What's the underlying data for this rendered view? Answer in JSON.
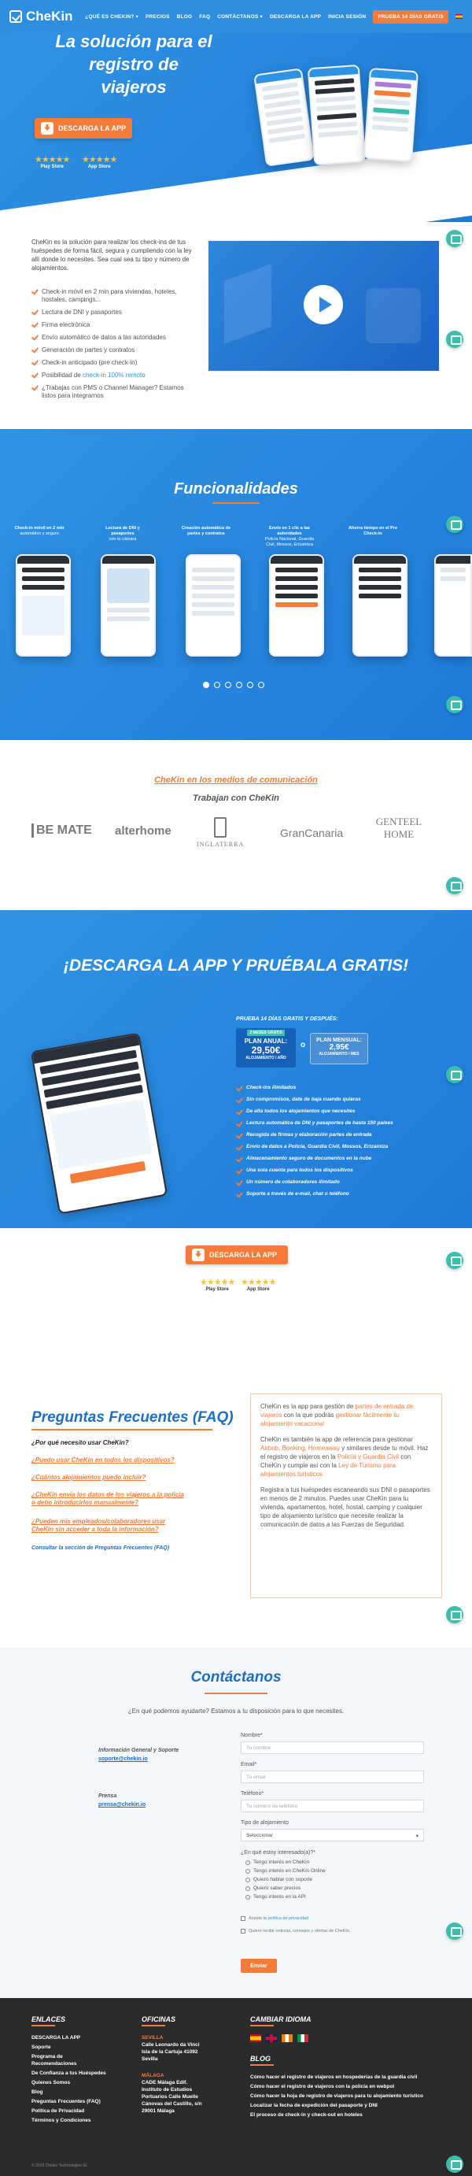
{
  "header": {
    "logo": "CheKin",
    "nav": [
      "¿QUÉ ES CHEKIN? ▾",
      "PRECIOS",
      "BLOG",
      "FAQ",
      "CONTÁCTANOS ▾",
      "DESCARGA LA APP",
      "INICIA SESIÓN"
    ],
    "trial": "PRUEBA 14 DÍAS GRATIS"
  },
  "hero": {
    "title": "La solución para el registro de viajeros",
    "download_btn": "DESCARGA LA APP",
    "stars": "★★★★★",
    "play_store": "Play Store",
    "app_store": "App Store"
  },
  "intro": {
    "text": "CheKin es la solución para realizar los check-ins de tus huéspedes de forma fácil, segura y cumpliendo con la ley allí donde lo necesites. Sea cual sea tu tipo y número de alojamientos.",
    "items": [
      "Check-in móvil en 2 min para viviendas, hoteles, hostales, campings...",
      "Lectura de DNI y pasaportes",
      "Firma electrónica",
      "Envío automático de datos a las autoridades",
      "Generación de partes y contratos",
      "Check-in anticipado (pre check-in)"
    ],
    "item_remote_pre": "Posibilidad de ",
    "item_remote_link": "check-in 100% remoto",
    "item_pms": "¿Trabajas con PMS o Channel Manager? Estamos listos para integrarnos"
  },
  "functions": {
    "title": "Funcionalidades",
    "labels": [
      "Check-in móvil en 2 min",
      "Lectura de DNI y pasaportes",
      "Creación automática de partes y contratos",
      "Envío en 1 clic a las autoridades",
      "Ahorra tiempo en el Pre Check-in",
      ""
    ],
    "sublabels": [
      "automático y seguro",
      "con tu cámara",
      "",
      "Policía Nacional, Guardia Civil, Mossos, Ertzaintza",
      "",
      ""
    ]
  },
  "media": {
    "title": "CheKin en los medios de comunicación",
    "subtitle": "Trabajan con CheKin",
    "brands": [
      "BE MATE",
      "alterhome",
      "INGLATERRA",
      "GranCanaria",
      "GENTEEL HOME"
    ]
  },
  "download": {
    "title": "¡DESCARGA LA APP Y PRUÉBALA GRATIS!",
    "trial_head": "PRUEBA 14 DÍAS GRATIS Y DESPUÉS:",
    "annual_badge": "2 MESES GRATIS",
    "annual_label": "PLAN ANUAL:",
    "annual_price": "29,50€",
    "annual_sub": "ALOJAMIENTO / AÑO",
    "or": "o",
    "monthly_label": "PLAN MENSUAL:",
    "monthly_price": "2,95€",
    "monthly_sub": "ALOJAMIENTO / MES",
    "features": [
      "Check-ins ilimitados",
      "Sin compromisos, date de baja cuando quieras",
      "De alta todos los alojamientos que necesites",
      "Lectura automática de DNI y pasaportes de hasta 150 países",
      "Recogida de firmas y elaboración partes de entrada",
      "Envío de datos a Policía, Guardia Civil, Mossos, Ertzaintza",
      "Almacenamiento seguro de documentos en la nube",
      "Una sola cuenta para todos los dispositivos",
      "Un número de colaboradores ilimitado",
      "Soporte a través de e-mail, chat o teléfono"
    ],
    "download_btn": "DESCARGA LA APP",
    "stars": "★★★★★",
    "play_store": "Play Store",
    "app_store": "App Store"
  },
  "faq": {
    "title": "Preguntas Frecuentes (FAQ)",
    "questions": [
      "¿Por qué necesito usar CheKin?",
      "¿Puedo usar CheKin en todos los dispositivos?",
      "¿Cuántos alojamientos puedo incluir?",
      "¿CheKin envía los datos de los viajeros a la policía o debo introducirlos manualmente?",
      "¿Pueden mis empleados/colaboradores usar CheKin sin acceder a toda la información?"
    ],
    "link": "Consultar la sección de Preguntas Frecuentes (FAQ)",
    "answer_p1_a": "CheKin es la app para gestión de ",
    "answer_p1_hl1": "partes de entrada de viajeros",
    "answer_p1_b": " con la que podrás ",
    "answer_p1_hl2": "gestionar fácilmente tu alojamiento vacacional",
    "answer_p2_a": "CheKin es también la app de referencia para gestionar ",
    "answer_p2_hl1": "Airbnb, Booking, Homeaway",
    "answer_p2_b": " y similares desde tu móvil. Haz el registro de viajeros en la ",
    "answer_p2_hl2": "Policía y Guardia Civil",
    "answer_p2_c": " con CheKin y cumple así con la ",
    "answer_p2_hl3": "Ley de Turismo para alojamientos turísticos",
    "answer_p3": "Registra a tus huéspedes escaneando sus DNI o pasaportes en menos de 2 minutos. Puedes usar CheKin para tu vivienda, apartamentos, hotel, hostal, camping y cualquier tipo de alojamiento turístico que necesite realizar la comunicación de datos a las Fuerzas de Seguridad."
  },
  "contact": {
    "title": "Contáctanos",
    "subtitle": "¿En qué podemos ayudarte? Estamos a tu disposición para lo que necesites.",
    "info_label": "Información General y Soporte",
    "info_email": "soporte@chekin.io",
    "press_label": "Prensa",
    "press_email": "prensa@chekin.io",
    "name_label": "Nombre*",
    "name_placeholder": "Tu nombre",
    "email_label": "Email*",
    "email_placeholder": "Tu email",
    "phone_label": "Teléfono*",
    "phone_placeholder": "Tu número de teléfono",
    "type_label": "Tipo de alojamiento",
    "type_value": "Seleccionar",
    "interest_label": "¿En qué estoy interesado(a)?*",
    "options": [
      "Tengo interés en CheKin",
      "Tengo interés en CheKin Online",
      "Quiero hablar con soporte",
      "Quiero saber precios",
      "Tengo interés en la API"
    ],
    "privacy_pre": "Acepto la ",
    "privacy_link": "política de privacidad",
    "news": "Quiero recibir noticias, consejos y ofertas de CheKin.",
    "send": "Enviar"
  },
  "footer": {
    "links_title": "ENLACES",
    "links": [
      "DESCARGA LA APP",
      "Soporte",
      "Programa de Recomendaciones",
      "De Confianza a tus Huéspedes",
      "Quienes Somos",
      "Blog",
      "Preguntas Frecuentes (FAQ)",
      "Política de Privacidad",
      "Términos y Condiciones"
    ],
    "offices_title": "OFICINAS",
    "sevilla_city": "SEVILLA",
    "sevilla_addr": "Calle Leonardo da Vinci Isla de la Cartuja 41092 Sevilla",
    "malaga_city": "MÁLAGA",
    "malaga_addr": "CADE Málaga Edif. Instituto de Estudios Portuarios Calle Muelle Cánovas del Castillo, s/n 29001 Málaga",
    "language_title": "CAMBIAR IDIOMA",
    "blog_title": "BLOG",
    "blog_posts": [
      "Cómo hacer el registro de viajeros en hospederías de la guardia civil",
      "Cómo hacer el registro de viajeros con la policía en webpol",
      "Cómo hacer la hoja de registro de viajeros para tu alojamiento turístico",
      "Localizar la fecha de expedición del pasaporte y DNI",
      "El proceso de check-in y check-out en hoteles"
    ],
    "copyright": "© 2019 Chekin Technologies SL"
  },
  "colors": {
    "primary": "#2f93e4",
    "accent": "#f47c38",
    "dark": "#2b2b2b",
    "chat": "#3bbfad"
  }
}
